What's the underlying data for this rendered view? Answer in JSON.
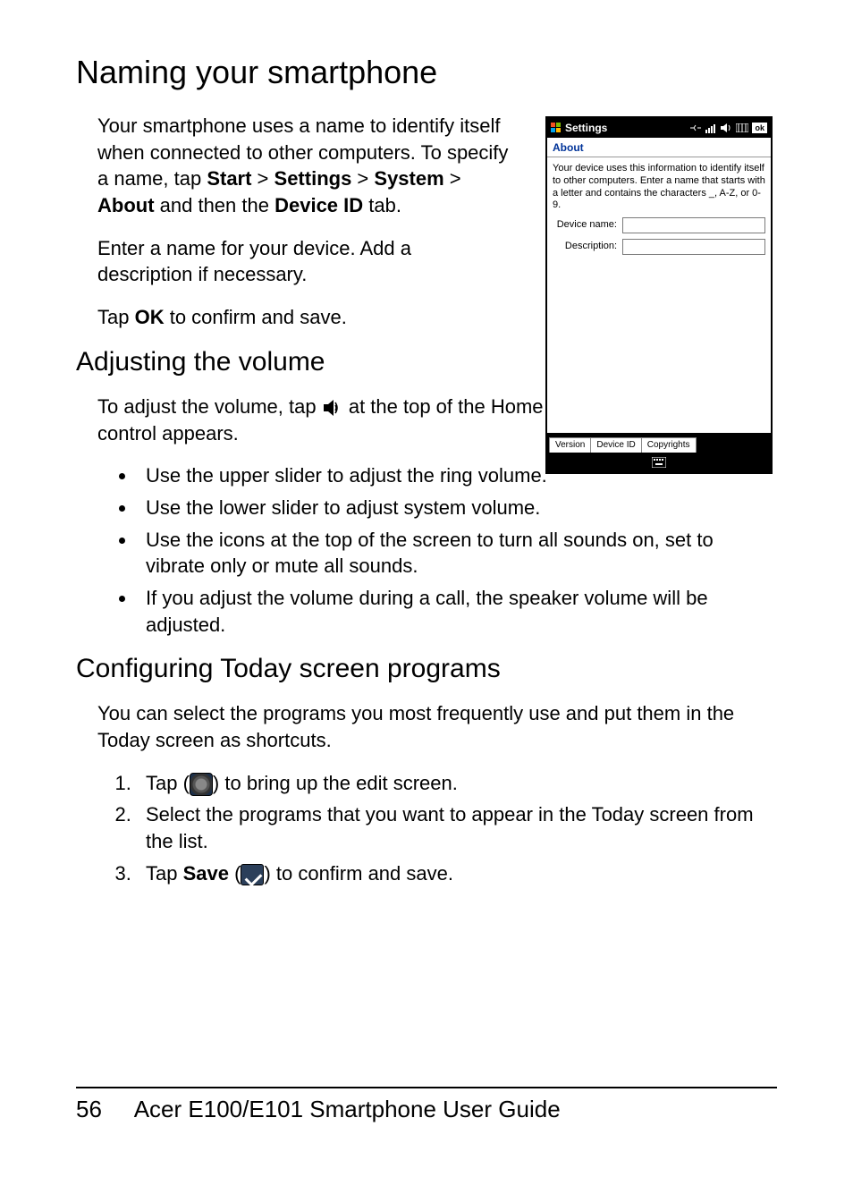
{
  "section1": {
    "heading": "Naming your smartphone",
    "p1_pre": "Your smartphone uses a name to identify itself when connected to other computers. To specify a name, tap ",
    "p1_b1": "Start",
    "p1_sep1": " > ",
    "p1_b2": "Settings",
    "p1_sep2": " > ",
    "p1_b3": "System",
    "p1_sep3": " > ",
    "p1_b4": "About",
    "p1_mid": " and then the ",
    "p1_b5": "Device ID",
    "p1_end": " tab.",
    "p2": "Enter a name for your device. Add a description if necessary.",
    "p3_pre": "Tap ",
    "p3_b": "OK",
    "p3_end": " to confirm and save."
  },
  "screenshot": {
    "title": "Settings",
    "about": "About",
    "note": "Your device uses this information to identify itself to other computers. Enter a name that starts with a letter and contains the characters _, A-Z, or 0-9.",
    "deviceNameLabel": "Device name:",
    "descriptionLabel": "Description:",
    "tabs": [
      "Version",
      "Device ID",
      "Copyrights"
    ],
    "ok": "ok"
  },
  "section2": {
    "heading": "Adjusting the volume",
    "p1_pre": "To adjust the volume, tap ",
    "p1_end": " at the top of the Home screen. The volume control appears.",
    "bullets": [
      "Use the upper slider to adjust the ring volume.",
      "Use the lower slider to adjust system volume.",
      "Use the icons at the top of the screen to turn all sounds on, set to vibrate only or mute all sounds.",
      "If you adjust the volume during a call, the speaker volume will be adjusted."
    ]
  },
  "section3": {
    "heading": "Configuring Today screen programs",
    "p1": "You can select the programs you most frequently use and put them in the Today screen as shortcuts.",
    "li1_pre": "Tap (",
    "li1_end": ") to bring up the edit screen.",
    "li2": "Select the programs that you want to appear in the Today screen from the list.",
    "li3_pre": "Tap ",
    "li3_b": "Save",
    "li3_mid": " (",
    "li3_end": ") to confirm and save."
  },
  "footer": {
    "page": "56",
    "title": "Acer E100/E101 Smartphone User Guide"
  }
}
